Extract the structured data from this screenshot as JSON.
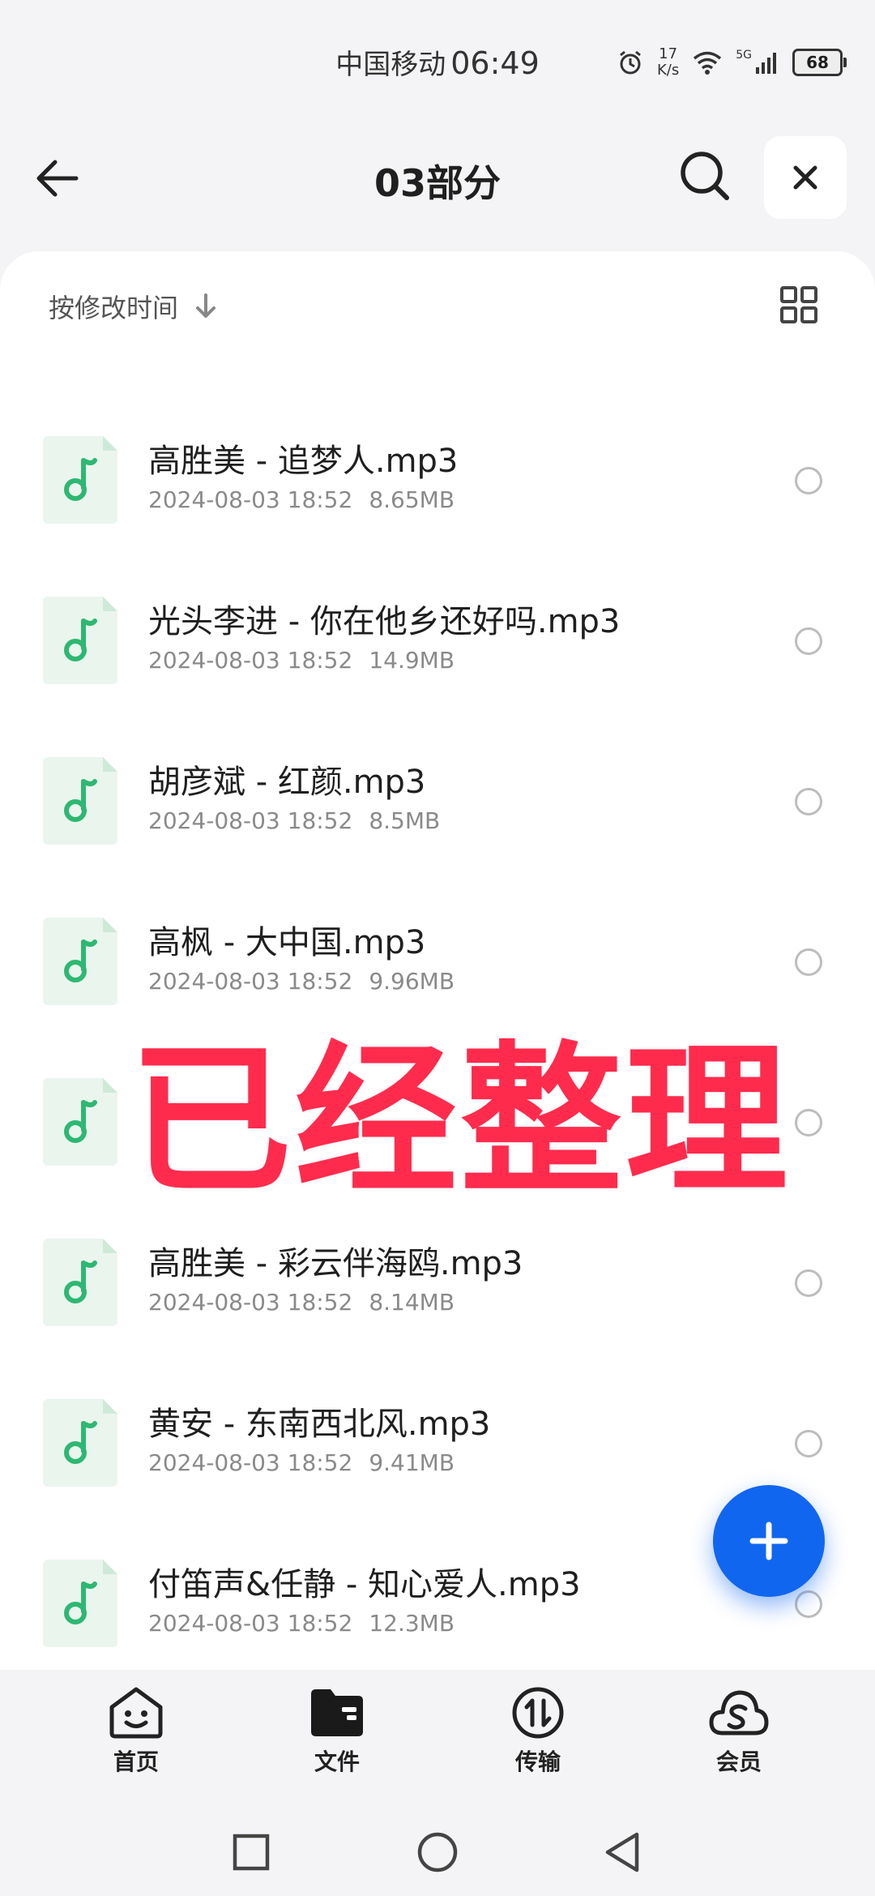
{
  "status_bar": {
    "carrier": "中国移动",
    "time": "06:49",
    "speed_top": "17",
    "speed_bottom": "K/s",
    "network": "5G",
    "battery": "68"
  },
  "header": {
    "title": "03部分"
  },
  "sort": {
    "label": "按修改时间"
  },
  "files": [
    {
      "name": "高胜美 - 追梦人.mp3",
      "date": "2024-08-03 18:52",
      "size": "8.65MB"
    },
    {
      "name": "光头李进 - 你在他乡还好吗.mp3",
      "date": "2024-08-03 18:52",
      "size": "14.9MB"
    },
    {
      "name": "胡彦斌 - 红颜.mp3",
      "date": "2024-08-03 18:52",
      "size": "8.5MB"
    },
    {
      "name": "高枫 - 大中国.mp3",
      "date": "2024-08-03 18:52",
      "size": "9.96MB"
    },
    {
      "name": "",
      "date": "",
      "size": ""
    },
    {
      "name": "高胜美 - 彩云伴海鸥.mp3",
      "date": "2024-08-03 18:52",
      "size": "8.14MB"
    },
    {
      "name": "黄安 - 东南西北风.mp3",
      "date": "2024-08-03 18:52",
      "size": "9.41MB"
    },
    {
      "name": "付笛声&任静 - 知心爱人.mp3",
      "date": "2024-08-03 18:52",
      "size": "12.3MB"
    }
  ],
  "overlay": {
    "text": "已经整理"
  },
  "bottom_nav": [
    {
      "label": "首页",
      "icon": "home-face-icon"
    },
    {
      "label": "文件",
      "icon": "folder-icon"
    },
    {
      "label": "传输",
      "icon": "transfer-icon"
    },
    {
      "label": "会员",
      "icon": "vip-cloud-icon"
    }
  ],
  "colors": {
    "accent": "#1166f0",
    "overlay": "#ff2b4d",
    "music_icon": "#2eb872"
  }
}
